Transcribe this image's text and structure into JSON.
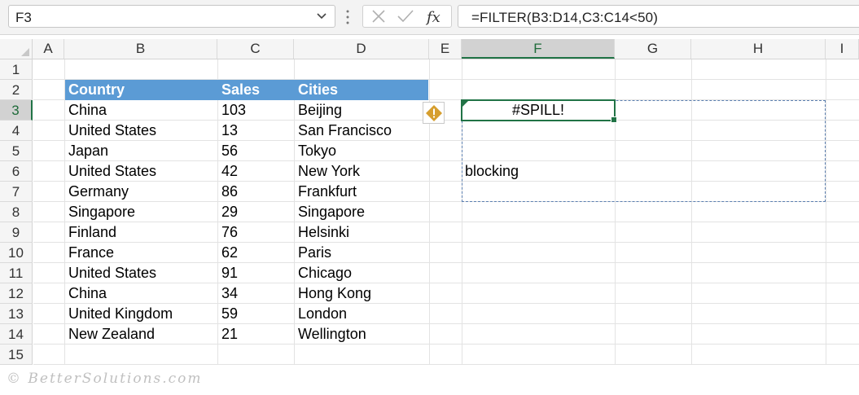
{
  "namebox": {
    "value": "F3"
  },
  "formula": {
    "text": "=FILTER(B3:D14,C3:C14<50)"
  },
  "columns": [
    "A",
    "B",
    "C",
    "D",
    "E",
    "F",
    "G",
    "H",
    "I"
  ],
  "rows": [
    "1",
    "2",
    "3",
    "4",
    "5",
    "6",
    "7",
    "8",
    "9",
    "10",
    "11",
    "12",
    "13",
    "14",
    "15"
  ],
  "table": {
    "headers": [
      "Country",
      "Sales",
      "Cities"
    ],
    "data": [
      [
        "China",
        "103",
        "Beijing"
      ],
      [
        "United States",
        "13",
        "San Francisco"
      ],
      [
        "Japan",
        "56",
        "Tokyo"
      ],
      [
        "United States",
        "42",
        "New York"
      ],
      [
        "Germany",
        "86",
        "Frankfurt"
      ],
      [
        "Singapore",
        "29",
        "Singapore"
      ],
      [
        "Finland",
        "76",
        "Helsinki"
      ],
      [
        "France",
        "62",
        "Paris"
      ],
      [
        "United States",
        "91",
        "Chicago"
      ],
      [
        "China",
        "34",
        "Hong Kong"
      ],
      [
        "United Kingdom",
        "59",
        "London"
      ],
      [
        "New Zealand",
        "21",
        "Wellington"
      ]
    ]
  },
  "active": {
    "spill_error": "#SPILL!",
    "blocking_text": "blocking"
  },
  "colors": {
    "header_fill": "#5b9bd5",
    "active_border": "#217346",
    "warning": "#d69e2e"
  },
  "watermark": "© BetterSolutions.com"
}
